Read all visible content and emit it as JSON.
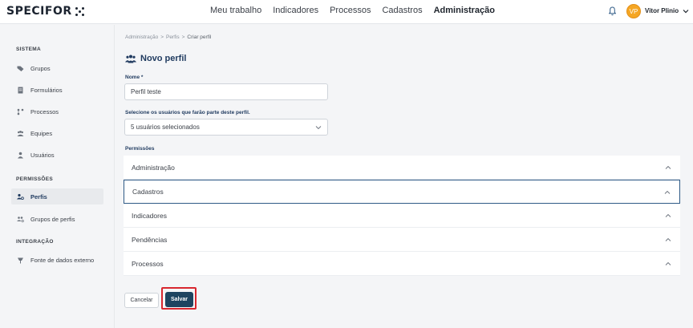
{
  "header": {
    "logo": "SPECIFOR",
    "nav": [
      "Meu trabalho",
      "Indicadores",
      "Processos",
      "Cadastros",
      "Administração"
    ],
    "active_nav": "Administração",
    "avatar_initials": "VP",
    "user_name": "Vitor Plinio",
    "icons": {
      "bell": "bell-icon",
      "chevron": "chevron-down-icon"
    }
  },
  "sidebar": {
    "sections": {
      "sistema": "SISTEMA",
      "permissoes": "PERMISSÕES",
      "integracao": "INTEGRAÇÃO"
    },
    "items": [
      {
        "label": "Grupos",
        "icon": "tag-icon"
      },
      {
        "label": "Formulários",
        "icon": "document-icon"
      },
      {
        "label": "Processos",
        "icon": "flow-icon"
      },
      {
        "label": "Equipes",
        "icon": "team-icon"
      },
      {
        "label": "Usuários",
        "icon": "user-icon"
      },
      {
        "label": "Perfis",
        "icon": "profile-icon",
        "active": true
      },
      {
        "label": "Grupos de perfis",
        "icon": "profile-group-icon"
      },
      {
        "label": "Fonte de dados externo",
        "icon": "plug-icon"
      }
    ]
  },
  "breadcrumb": {
    "items": [
      "Administração",
      "Perfis",
      "Criar perfil"
    ],
    "separator": ">"
  },
  "page": {
    "title": "Novo perfil",
    "title_icon": "users-icon"
  },
  "form": {
    "name_label": "Nome *",
    "name_value": "Perfil teste",
    "users_label": "Selecione os usuários que farão parte deste perfil.",
    "users_value": "5 usuários selecionados",
    "permissions_label": "Permissões",
    "permissions": [
      "Administração",
      "Cadastros",
      "Indicadores",
      "Pendências",
      "Processos"
    ],
    "focused_permission": "Cadastros"
  },
  "actions": {
    "cancel": "Cancelar",
    "save": "Salvar"
  },
  "colors": {
    "primary": "#1e4460",
    "title": "#1f3a5f",
    "avatar": "#f5a623",
    "highlight": "#d8272f"
  }
}
